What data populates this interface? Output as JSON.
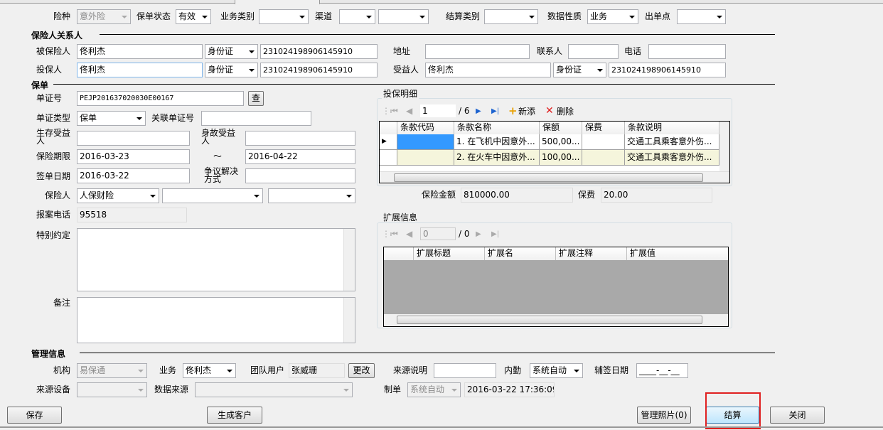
{
  "top": {
    "insurance_type_label": "险种",
    "insurance_type": "意外险",
    "policy_status_label": "保单状态",
    "policy_status": "有效",
    "business_category_label": "业务类别",
    "business_category": "",
    "channel_label": "渠道",
    "channel": "",
    "channel2": "",
    "settlement_category_label": "结算类别",
    "settlement_category": "",
    "data_nature_label": "数据性质",
    "data_nature": "业务",
    "issuing_point_label": "出单点",
    "issuing_point": ""
  },
  "parties": {
    "title": "保险人关系人",
    "insured_label": "被保险人",
    "insured_name": "佟利杰",
    "insured_id_type": "身份证",
    "insured_id": "231024198906145910",
    "address_label": "地址",
    "address": "",
    "contact_label": "联系人",
    "contact": "",
    "phone_label": "电话",
    "phone": "",
    "applicant_label": "投保人",
    "applicant_name": "佟利杰",
    "applicant_id_type": "身份证",
    "applicant_id": "231024198906145910",
    "beneficiary_label": "受益人",
    "beneficiary_name": "佟利杰",
    "beneficiary_id_type": "身份证",
    "beneficiary_id": "231024198906145910"
  },
  "policy": {
    "title": "保单",
    "doc_no_label": "单证号",
    "doc_no": "PEJP201637020030E00167",
    "query_button": "查",
    "doc_type_label": "单证类型",
    "doc_type": "保单",
    "related_doc_label": "关联单证号",
    "related_doc": "",
    "survival_beneficiary_label": "生存受益人",
    "survival_beneficiary": "",
    "death_beneficiary_label": "身故受益人",
    "death_beneficiary": "",
    "period_label": "保险期限",
    "period_start": "2016-03-23",
    "period_sep": "～",
    "period_end": "2016-04-22",
    "sign_date_label": "签单日期",
    "sign_date": "2016-03-22",
    "dispute_label": "争议解决方式",
    "dispute": "",
    "insurer_label": "保险人",
    "insurer": "人保财险",
    "insurer2": "",
    "insurer3": "",
    "report_phone_label": "报案电话",
    "report_phone": "95518",
    "special_label": "特别约定",
    "remarks_label": "备注"
  },
  "details": {
    "title": "投保明细",
    "page": "1",
    "total": "/ 6",
    "add": "新添",
    "delete": "删除",
    "columns": [
      "条款代码",
      "条款名称",
      "保额",
      "保费",
      "条款说明"
    ],
    "rows": [
      [
        "",
        "1. 在飞机中因意外...",
        "500,00...",
        "",
        "交通工具乘客意外伤..."
      ],
      [
        "",
        "2. 在火车中因意外...",
        "100,00...",
        "",
        "交通工具乘客意外伤..."
      ]
    ],
    "sum_insured_label": "保险金额",
    "sum_insured": "810000.00",
    "premium_label": "保费",
    "premium": "20.00"
  },
  "ext": {
    "title": "扩展信息",
    "page": "0",
    "total": "/ 0",
    "columns": [
      "扩展标题",
      "扩展名",
      "扩展注释",
      "扩展值"
    ]
  },
  "mgmt": {
    "title": "管理信息",
    "org_label": "机构",
    "org": "易保通",
    "biz_label": "业务",
    "biz": "佟利杰",
    "team_user_label": "团队用户",
    "team_user": "张威珊",
    "change_button": "更改",
    "source_desc_label": "来源说明",
    "source_desc": "",
    "clerk_label": "内勤",
    "clerk": "系统自动",
    "assist_date_label": "辅签日期",
    "assist_date": "____-__-__",
    "source_device_label": "来源设备",
    "source_device": "",
    "data_source_label": "数据来源",
    "data_source": "",
    "maker_label": "制单",
    "maker": "系统自动",
    "make_time": "2016-03-22 17:36:09"
  },
  "buttons": {
    "save": "保存",
    "create_customer": "生成客户",
    "manage_photos": "管理照片(0)",
    "settle": "结算",
    "close": "关闭"
  },
  "colors": {
    "highlight": "#3399ff",
    "row_alt": "#f5f5dc",
    "red_box": "#e02020"
  }
}
